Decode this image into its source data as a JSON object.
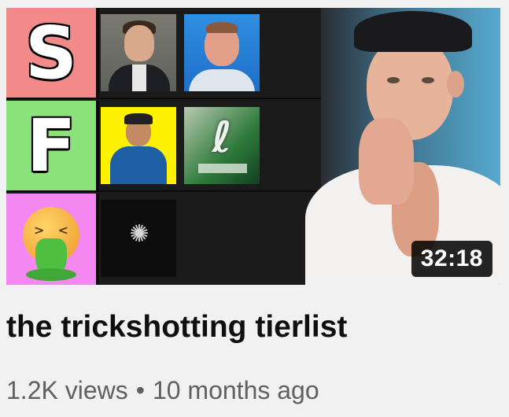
{
  "video": {
    "title": "the trickshotting tierlist",
    "views": "1.2K views",
    "separator": "•",
    "age": "10 months ago",
    "duration": "32:18"
  },
  "thumbnail": {
    "tiers": [
      {
        "label": "S",
        "color": "#f28a8a"
      },
      {
        "label": "F",
        "color": "#8be27a"
      },
      {
        "label": "",
        "color": "#f487f0",
        "icon": "vomiting-face-emoji"
      }
    ],
    "accent_colors": {
      "background": "#1b1b1b",
      "duration_bg": "#000000"
    }
  }
}
